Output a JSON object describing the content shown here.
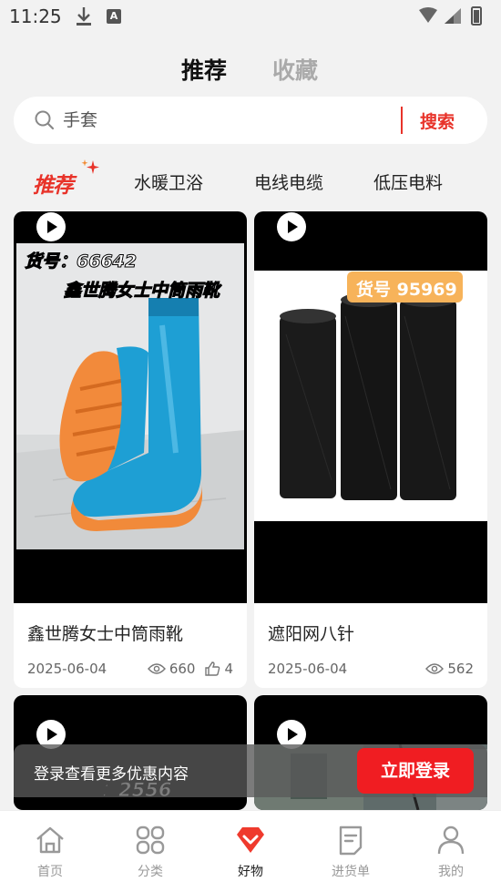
{
  "status": {
    "time": "11:25",
    "badge": "A"
  },
  "tabs": [
    {
      "label": "推荐",
      "active": true
    },
    {
      "label": "收藏",
      "active": false
    }
  ],
  "search": {
    "placeholder": "手套",
    "button": "搜索"
  },
  "categories": {
    "logo": "推荐",
    "items": [
      "水暖卫浴",
      "电线电缆",
      "低压电料"
    ]
  },
  "products": [
    {
      "title": "鑫世腾女士中筒雨靴",
      "date": "2025-06-04",
      "views": "660",
      "likes": "4",
      "image_caption_top": "货号：66642",
      "image_caption_sub": "鑫世腾女士中筒雨靴"
    },
    {
      "title": "遮阳网八针",
      "date": "2025-06-04",
      "views": "562",
      "image_caption_top": "货号 95969"
    },
    {
      "image_caption_top": "货号：2556"
    },
    {}
  ],
  "login_banner": {
    "text": "登录查看更多优惠内容",
    "button": "立即登录"
  },
  "nav": [
    {
      "label": "首页",
      "icon": "home-icon"
    },
    {
      "label": "分类",
      "icon": "category-icon"
    },
    {
      "label": "好物",
      "icon": "goods-icon",
      "active": true
    },
    {
      "label": "进货单",
      "icon": "order-icon"
    },
    {
      "label": "我的",
      "icon": "profile-icon"
    }
  ],
  "colors": {
    "accent": "#e8332a",
    "login_button": "#f01d22",
    "background": "#f2f2f2"
  }
}
